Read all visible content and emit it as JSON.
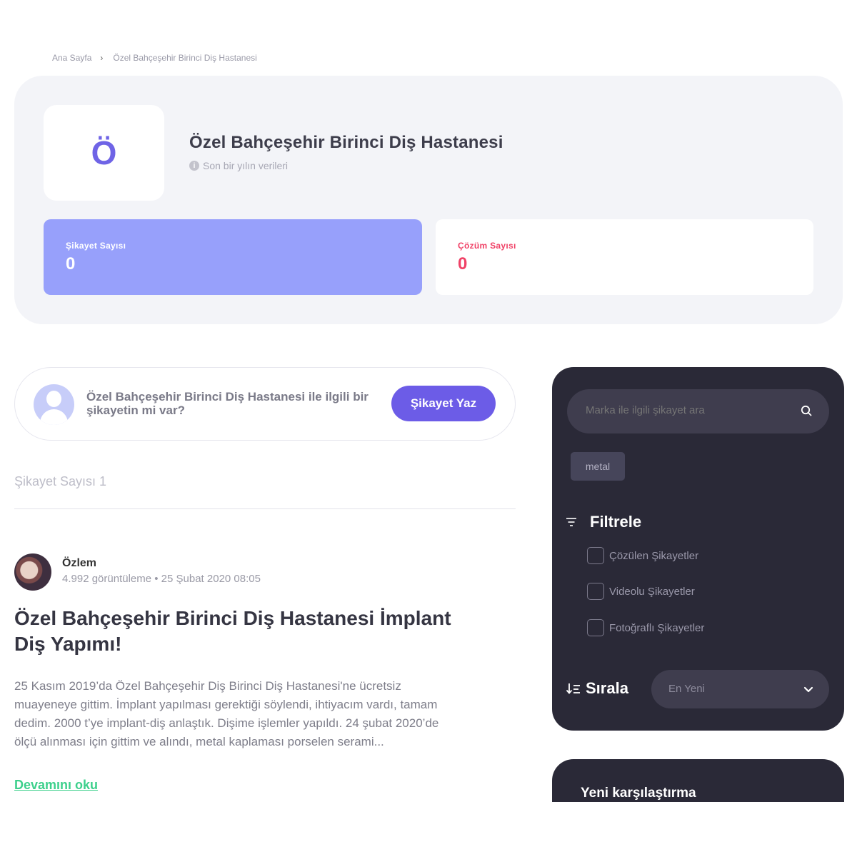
{
  "breadcrumb": {
    "home": "Ana Sayfa",
    "separator": "›",
    "current": "Özel Bahçeşehir Birinci Diş Hastanesi"
  },
  "brand": {
    "logo_letter": "Ö",
    "name": "Özel Bahçeşehir Birinci Diş Hastanesi",
    "info_icon": "i",
    "subtitle": "Son bir yılın verileri",
    "stats": {
      "complaint_label": "Şikayet Sayısı",
      "complaint_value": "0",
      "solution_label": "Çözüm Sayısı",
      "solution_value": "0"
    }
  },
  "cta": {
    "text": "Özel Bahçeşehir Birinci Diş Hastanesi ile ilgili bir şikayetin mi var?",
    "button": "Şikayet Yaz"
  },
  "list": {
    "count_label": "Şikayet Sayısı 1"
  },
  "complaint": {
    "user": "Özlem",
    "meta": "4.992 görüntüleme • 25 Şubat 2020 08:05",
    "title": "Özel Bahçeşehir Birinci Diş Hastanesi İmplant Diş  Yapımı!",
    "excerpt": "25 Kasım 2019’da Özel Bahçeşehir Diş Birinci Diş  Hastanesi'ne ücretsiz muayeneye gittim. İmplant yapılması gerektiği söylendi, ihtiyacım vardı, tamam dedim. 2000 t’ye implant-diş anlaştık. Dişime işlemler  yapıldı. 24 şubat 2020’de ölçü alınması için gittim ve alındı, metal kaplaması porselen serami...",
    "read_more": "Devamını oku"
  },
  "sidebar": {
    "search_placeholder": "Marka ile ilgili şikayet ara",
    "search_icon": "search-icon",
    "tags": [
      "metal"
    ],
    "filter_title": "Filtrele",
    "filters": [
      "Çözülen Şikayetler",
      "Videolu Şikayetler",
      "Fotoğraflı Şikayetler"
    ],
    "sort_title": "Sırala",
    "sort_value": "En Yeni"
  },
  "compare": {
    "title": "Yeni karşılaştırma"
  },
  "colors": {
    "accent": "#6c5ce7",
    "complaint_card": "#97a0fb",
    "solution_text": "#f04267",
    "read_more": "#3dd08c",
    "sidebar_bg": "#2a2937"
  }
}
